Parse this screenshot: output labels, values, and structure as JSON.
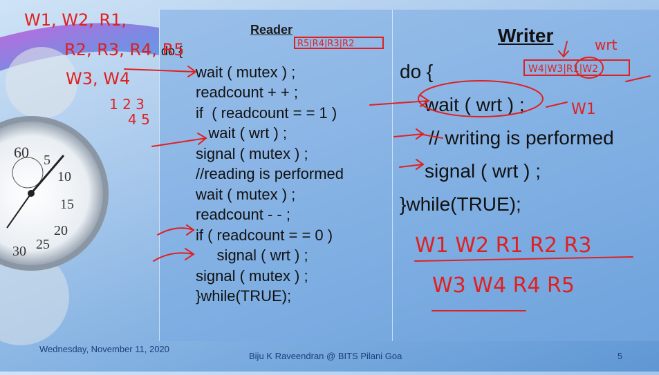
{
  "slide": {
    "reader": {
      "title": "Reader",
      "code": [
        "do {",
        "wait ( mutex ) ;",
        "readcount + + ;",
        "if  ( readcount = = 1 )",
        "   wait ( wrt ) ;",
        "signal ( mutex ) ;",
        "//reading is performed",
        "wait ( mutex ) ;",
        "readcount - - ;",
        "if ( readcount = = 0 )",
        "     signal ( wrt ) ;",
        "signal ( mutex ) ;",
        "}while(TRUE);"
      ]
    },
    "writer": {
      "title": "Writer",
      "code": [
        "do {",
        "wait ( wrt ) ;",
        "// writing is performed",
        "signal ( wrt ) ;",
        "}while(TRUE);"
      ]
    },
    "footer": {
      "date": "Wednesday, November 11, 2020",
      "author": "Biju K Raveendran @ BITS Pilani Goa",
      "page": "5"
    },
    "annotations": {
      "top_left_1": "W1, W2, R1,",
      "top_left_2": "R2, R3, R4, R5",
      "top_left_3": "W3, W4",
      "nums_1": "1 2 3",
      "nums_2": "4 5",
      "reader_queue": "R5|R4|R3|R2",
      "writer_label": "wrt",
      "writer_queue": "W4|W3|R1|W2",
      "w1_label": "W1",
      "bottom_1": "W1  W2  R1  R2  R3",
      "bottom_2": "W3  W4  R4  R5"
    },
    "colors": {
      "ink": "#e02020",
      "text": "#111111",
      "footer": "#1a3f7a"
    }
  }
}
